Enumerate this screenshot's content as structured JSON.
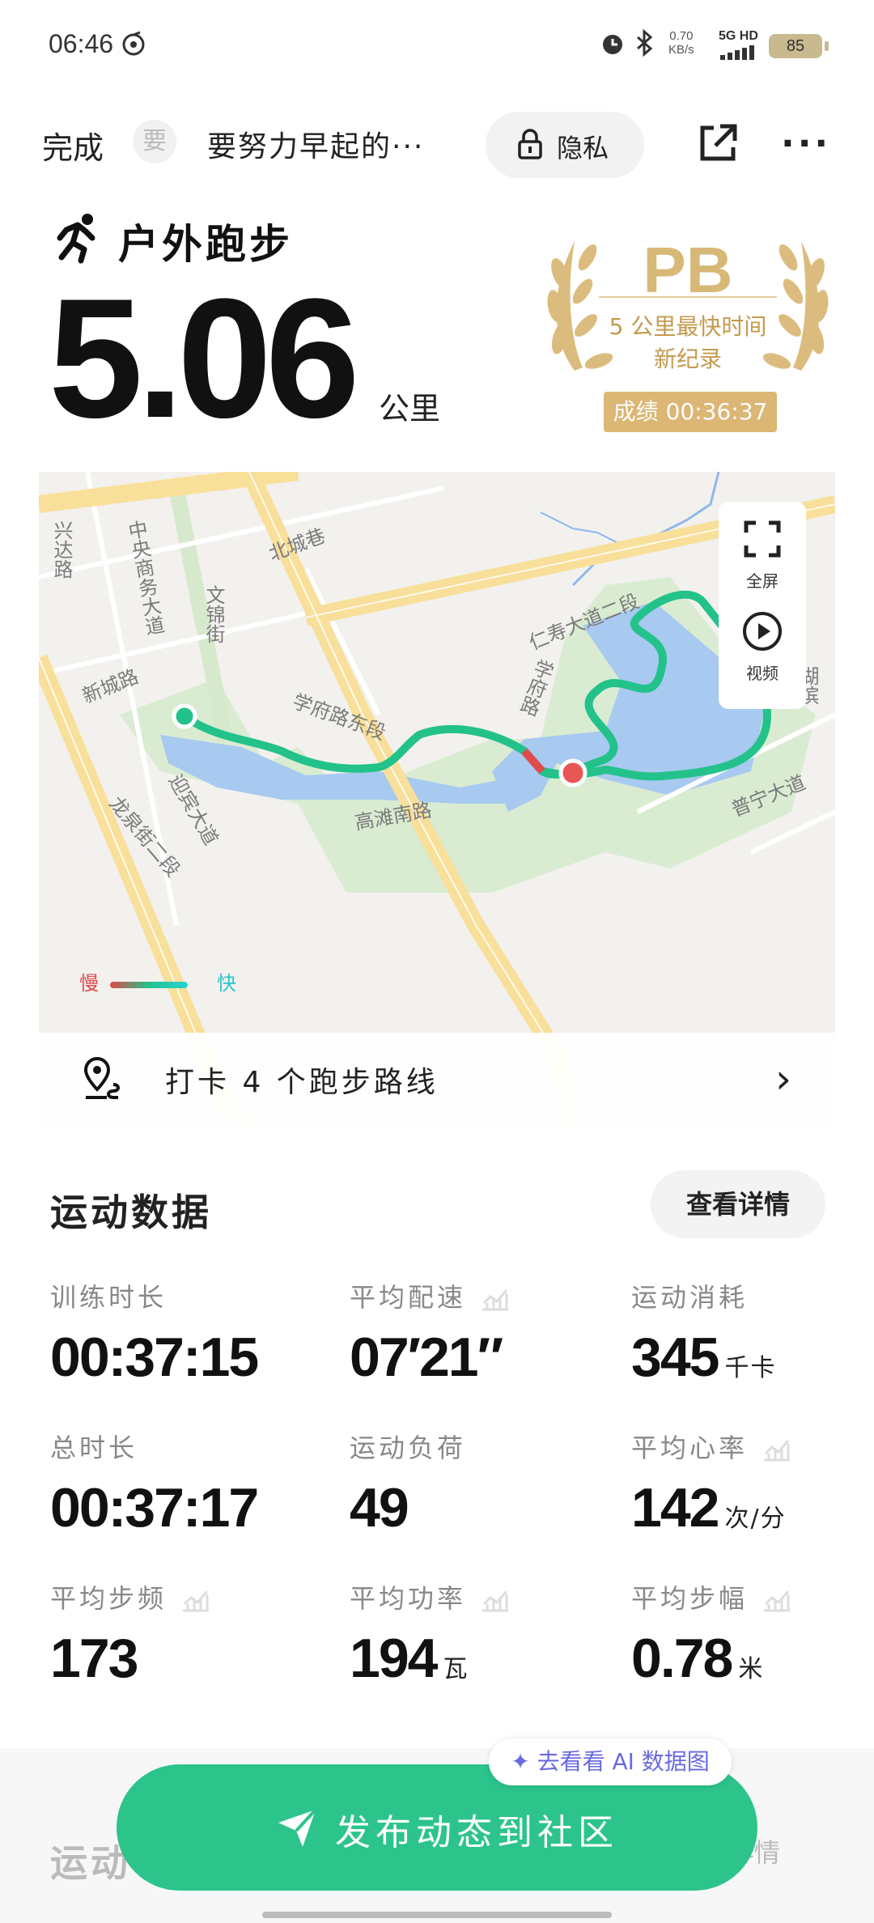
{
  "status_bar": {
    "time": "06:46",
    "net_speed": "0.70",
    "net_unit": "KB/s",
    "signal": "5G HD",
    "battery": "85"
  },
  "top_bar": {
    "done_label": "完成",
    "avatar_text": "要",
    "username": "要努力早起的···",
    "privacy_label": "隐私"
  },
  "activity": {
    "type": "户外跑步",
    "distance": "5.06",
    "distance_unit": "公里"
  },
  "pb_badge": {
    "title": "PB",
    "subtitle_line1": "5 公里最快时间",
    "subtitle_line2": "新纪录",
    "score": "成绩 00:36:37"
  },
  "map": {
    "controls": {
      "fullscreen": "全屏",
      "video": "视频"
    },
    "legend": {
      "slow": "慢",
      "fast": "快"
    },
    "street_labels": [
      "兴达路",
      "中央商务大道",
      "北城巷",
      "文锦街",
      "新城路",
      "仁寿大道二段",
      "学府路",
      "学府路东段",
      "高滩南路",
      "普宁大道",
      "湖滨",
      "迎宾大道",
      "龙泉街二段"
    ],
    "checkin_label": "打卡 4 个跑步路线"
  },
  "sport_data": {
    "title": "运动数据",
    "details_button": "查看详情",
    "metrics": [
      {
        "label": "训练时长",
        "value": "00:37:15",
        "unit": ""
      },
      {
        "label": "平均配速",
        "value": "07′21″",
        "unit": ""
      },
      {
        "label": "运动消耗",
        "value": "345",
        "unit": "千卡"
      },
      {
        "label": "总时长",
        "value": "00:37:17",
        "unit": ""
      },
      {
        "label": "运动负荷",
        "value": "49",
        "unit": ""
      },
      {
        "label": "平均心率",
        "value": "142",
        "unit": "次/分"
      },
      {
        "label": "平均步频",
        "value": "173",
        "unit": ""
      },
      {
        "label": "平均功率",
        "value": "194",
        "unit": "瓦"
      },
      {
        "label": "平均步幅",
        "value": "0.78",
        "unit": "米"
      }
    ]
  },
  "bottom": {
    "ai_pill": "去看看 AI 数据图",
    "faded_section_title": "运动",
    "faded_button": "详情",
    "publish_label": "发布动态到社区"
  },
  "colors": {
    "accent_green": "#2cc48b",
    "route_green": "#23c28a",
    "water": "#a8c9f0",
    "park": "#d9ecd2",
    "pb_gold": "#d8b877"
  }
}
